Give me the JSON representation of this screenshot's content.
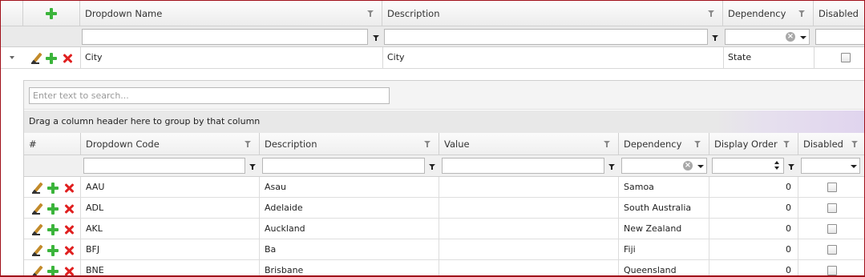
{
  "outer": {
    "columns": [
      "Dropdown Name",
      "Description",
      "Dependency",
      "Disabled"
    ],
    "row": {
      "name": "City",
      "description": "City",
      "dependency": "State",
      "disabled": false
    }
  },
  "detail": {
    "search_placeholder": "Enter text to search...",
    "group_panel_text": "Drag a column header here to group by that column",
    "columns": [
      "#",
      "Dropdown Code",
      "Description",
      "Value",
      "Dependency",
      "Display Order",
      "Disabled"
    ],
    "rows": [
      {
        "code": "AAU",
        "description": "Asau",
        "value": "",
        "dependency": "Samoa",
        "order": "0",
        "disabled": false
      },
      {
        "code": "ADL",
        "description": "Adelaide",
        "value": "",
        "dependency": "South Australia",
        "order": "0",
        "disabled": false
      },
      {
        "code": "AKL",
        "description": "Auckland",
        "value": "",
        "dependency": "New Zealand",
        "order": "0",
        "disabled": false
      },
      {
        "code": "BFJ",
        "description": "Ba",
        "value": "",
        "dependency": "Fiji",
        "order": "0",
        "disabled": false
      },
      {
        "code": "BNE",
        "description": "Brisbane",
        "value": "",
        "dependency": "Queensland",
        "order": "0",
        "disabled": false
      }
    ]
  },
  "icons": {
    "add": "plus-icon",
    "edit": "pencil-icon",
    "delete": "delete-icon",
    "filter": "filter-icon",
    "expand": "expand-arrow-icon",
    "clear": "clear-icon"
  },
  "colors": {
    "frame_border": "#a0101a",
    "add_green": "#3bb43b",
    "delete_red": "#e02020"
  }
}
